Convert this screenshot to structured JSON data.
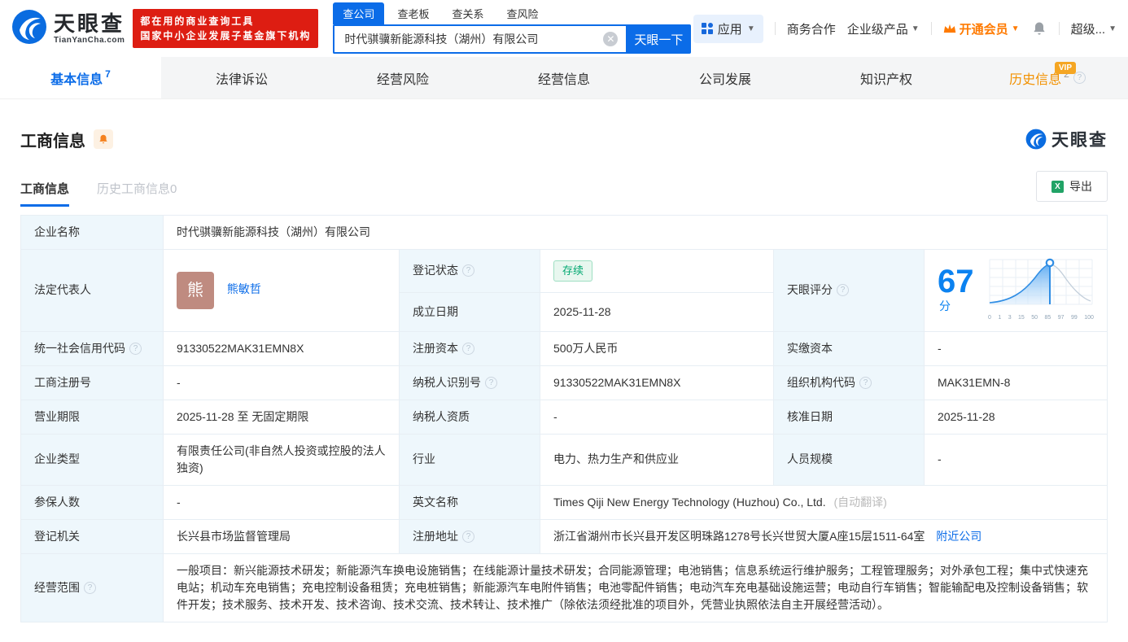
{
  "header": {
    "logo": {
      "brand": "天眼查",
      "domain": "TianYanCha.com"
    },
    "promo": {
      "line1": "都在用的商业查询工具",
      "line2": "国家中小企业发展子基金旗下机构"
    },
    "search": {
      "tabs": [
        {
          "label": "查公司"
        },
        {
          "label": "查老板"
        },
        {
          "label": "查关系"
        },
        {
          "label": "查风险"
        }
      ],
      "value": "时代骐骥新能源科技（湖州）有限公司",
      "button": "天眼一下"
    },
    "nav": {
      "apps": "应用",
      "business": "商务合作",
      "enterprise": "企业级产品",
      "vip": "开通会员",
      "super": "超级..."
    }
  },
  "tabs": [
    {
      "label": "基本信息",
      "count": "7"
    },
    {
      "label": "法律诉讼"
    },
    {
      "label": "经营风险"
    },
    {
      "label": "经营信息"
    },
    {
      "label": "公司发展"
    },
    {
      "label": "知识产权"
    },
    {
      "label": "历史信息",
      "count": "2",
      "badge": "VIP"
    }
  ],
  "section": {
    "title": "工商信息",
    "watermark_brand": "天眼查",
    "subtabs": [
      {
        "label": "工商信息"
      },
      {
        "label": "历史工商信息0"
      }
    ],
    "export_label": "导出"
  },
  "biz": {
    "company_name": {
      "label": "企业名称",
      "value": "时代骐骥新能源科技（湖州）有限公司"
    },
    "legal_rep": {
      "label": "法定代表人",
      "avatar_char": "熊",
      "name": "熊敏哲"
    },
    "reg_status": {
      "label": "登记状态",
      "value": "存续"
    },
    "establish_date": {
      "label": "成立日期",
      "value": "2025-11-28"
    },
    "tyc_score": {
      "label": "天眼评分",
      "value": "67",
      "unit": "分"
    },
    "credit_code": {
      "label": "统一社会信用代码",
      "value": "91330522MAK31EMN8X"
    },
    "reg_capital": {
      "label": "注册资本",
      "value": "500万人民币"
    },
    "paid_capital": {
      "label": "实缴资本",
      "value": "-"
    },
    "reg_number": {
      "label": "工商注册号",
      "value": "-"
    },
    "taxpayer_id": {
      "label": "纳税人识别号",
      "value": "91330522MAK31EMN8X"
    },
    "org_code": {
      "label": "组织机构代码",
      "value": "MAK31EMN-8"
    },
    "business_term": {
      "label": "营业期限",
      "value": "2025-11-28 至 无固定期限"
    },
    "taxpayer_qualification": {
      "label": "纳税人资质",
      "value": "-"
    },
    "approval_date": {
      "label": "核准日期",
      "value": "2025-11-28"
    },
    "company_type": {
      "label": "企业类型",
      "value": "有限责任公司(非自然人投资或控股的法人独资)"
    },
    "industry": {
      "label": "行业",
      "value": "电力、热力生产和供应业"
    },
    "staff_size": {
      "label": "人员规模",
      "value": "-"
    },
    "insured_count": {
      "label": "参保人数",
      "value": "-"
    },
    "english_name": {
      "label": "英文名称",
      "value": "Times Qiji New Energy Technology (Huzhou) Co., Ltd.",
      "note": "(自动翻译)"
    },
    "registry_authority": {
      "label": "登记机关",
      "value": "长兴县市场监督管理局"
    },
    "reg_address": {
      "label": "注册地址",
      "value": "浙江省湖州市长兴县开发区明珠路1278号长兴世贸大厦A座15层1511-64室",
      "link": "附近公司"
    },
    "business_scope": {
      "label": "经营范围",
      "value": "一般项目：新兴能源技术研发；新能源汽车换电设施销售；在线能源计量技术研发；合同能源管理；电池销售；信息系统运行维护服务；工程管理服务；对外承包工程；集中式快速充电站；机动车充电销售；充电控制设备租赁；充电桩销售；新能源汽车电附件销售；电池零配件销售；电动汽车充电基础设施运营；电动自行车销售；智能输配电及控制设备销售；软件开发；技术服务、技术开发、技术咨询、技术交流、技术转让、技术推广（除依法须经批准的项目外，凭营业执照依法自主开展经营活动）。"
    }
  },
  "chart_data": {
    "type": "area",
    "title": "天眼评分分布曲线",
    "score": 67,
    "marker_value": 67,
    "x_ticks": [
      "0",
      "1",
      "3",
      "15",
      "50",
      "85",
      "97",
      "99",
      "100"
    ],
    "grid": true,
    "accent_color": "#0b82f0",
    "fill_color": "#bfe0fb"
  }
}
